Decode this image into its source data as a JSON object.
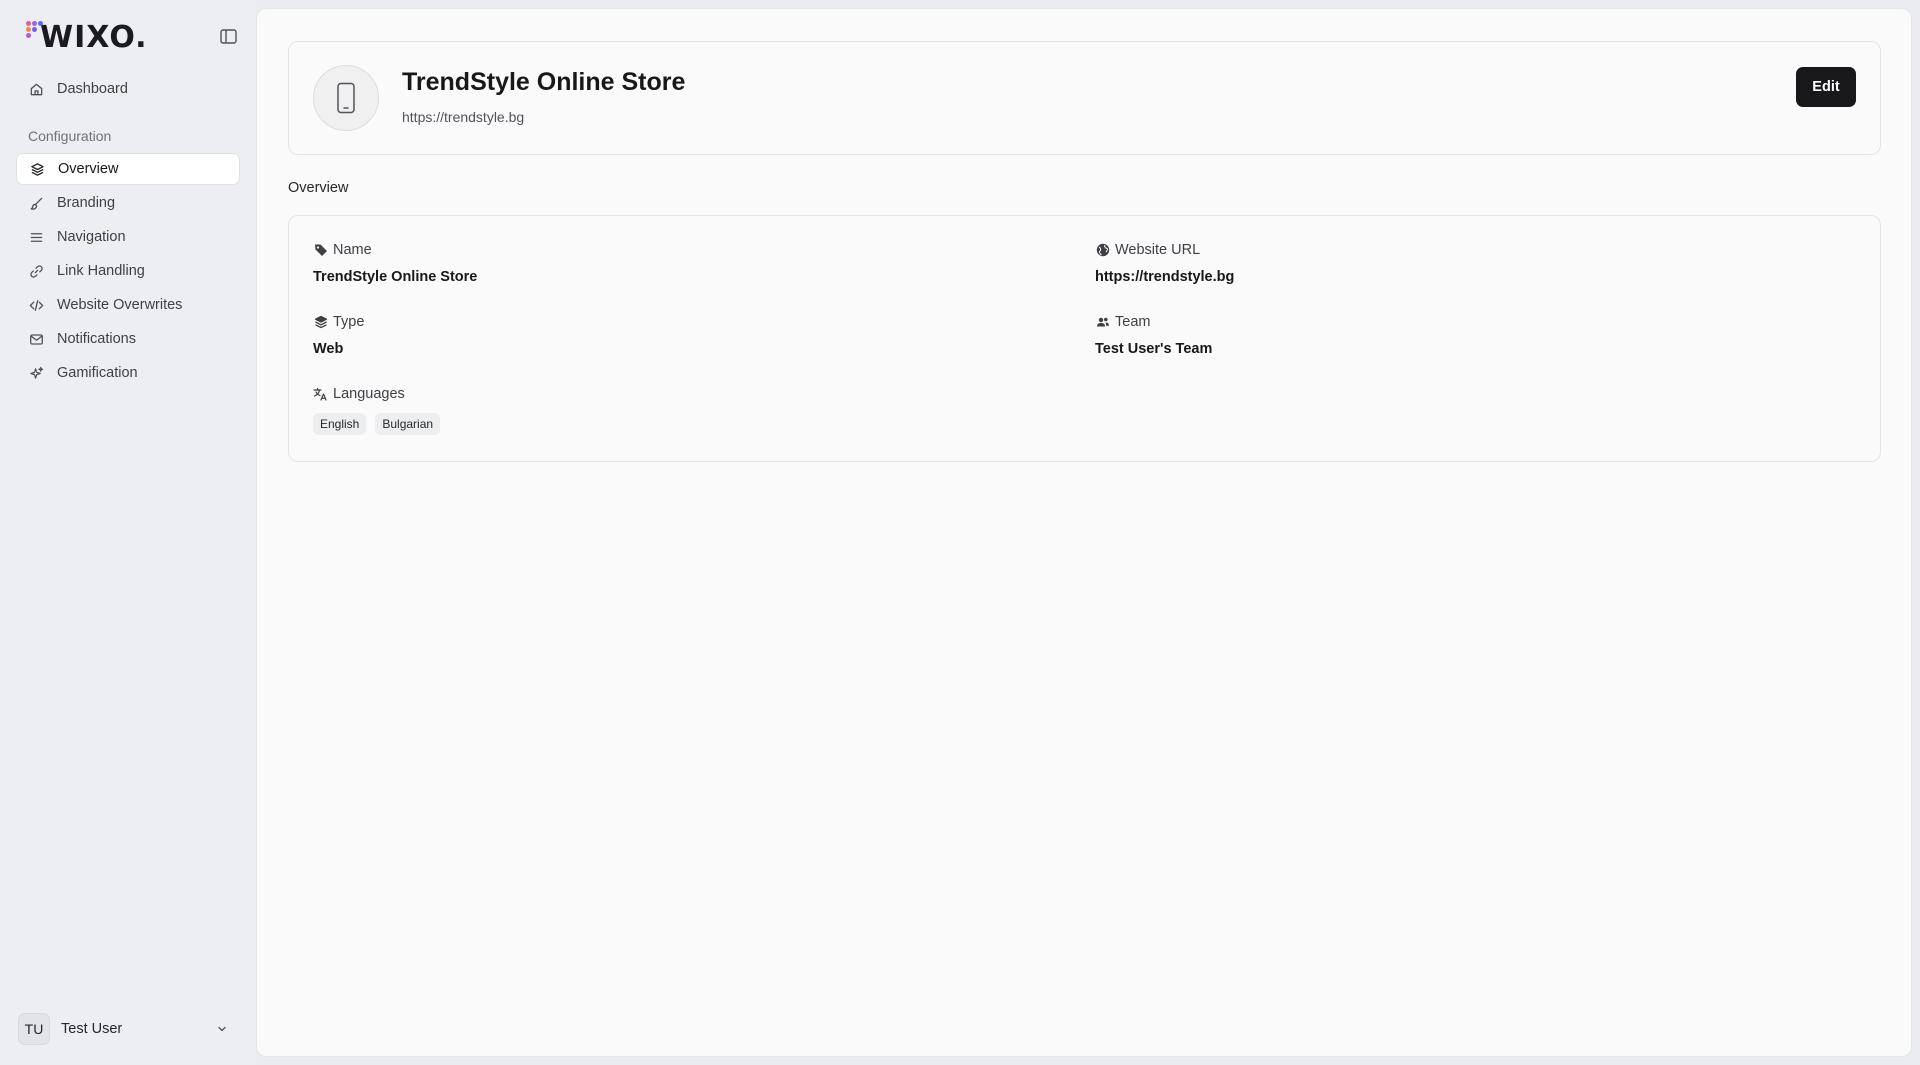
{
  "brand": {
    "name": "WIXO.",
    "dot_colors": [
      "#e85a9b",
      "#a45ee8",
      "#5a6df0",
      "#f08a4b",
      "#7b5ce6",
      "#c155d8"
    ]
  },
  "sidebar": {
    "dashboard_label": "Dashboard",
    "section_label": "Configuration",
    "items": [
      {
        "label": "Overview",
        "icon": "layers-icon",
        "active": true
      },
      {
        "label": "Branding",
        "icon": "brush-icon"
      },
      {
        "label": "Navigation",
        "icon": "menu-icon"
      },
      {
        "label": "Link Handling",
        "icon": "link-icon"
      },
      {
        "label": "Website Overwrites",
        "icon": "code-icon"
      },
      {
        "label": "Notifications",
        "icon": "mail-icon"
      },
      {
        "label": "Gamification",
        "icon": "sparkles-icon"
      }
    ],
    "user": {
      "initials": "TU",
      "name": "Test User"
    }
  },
  "header": {
    "title": "TrendStyle Online Store",
    "url": "https://trendstyle.bg",
    "edit_label": "Edit"
  },
  "overview": {
    "section_title": "Overview",
    "name_label": "Name",
    "name_value": "TrendStyle Online Store",
    "website_label": "Website URL",
    "website_value": "https://trendstyle.bg",
    "type_label": "Type",
    "type_value": "Web",
    "team_label": "Team",
    "team_value": "Test User's Team",
    "languages_label": "Languages",
    "languages": [
      "English",
      "Bulgarian"
    ]
  },
  "colors": {
    "accent": "#18181b",
    "sidebar_bg": "#eceef1",
    "main_bg": "#fafafa"
  }
}
